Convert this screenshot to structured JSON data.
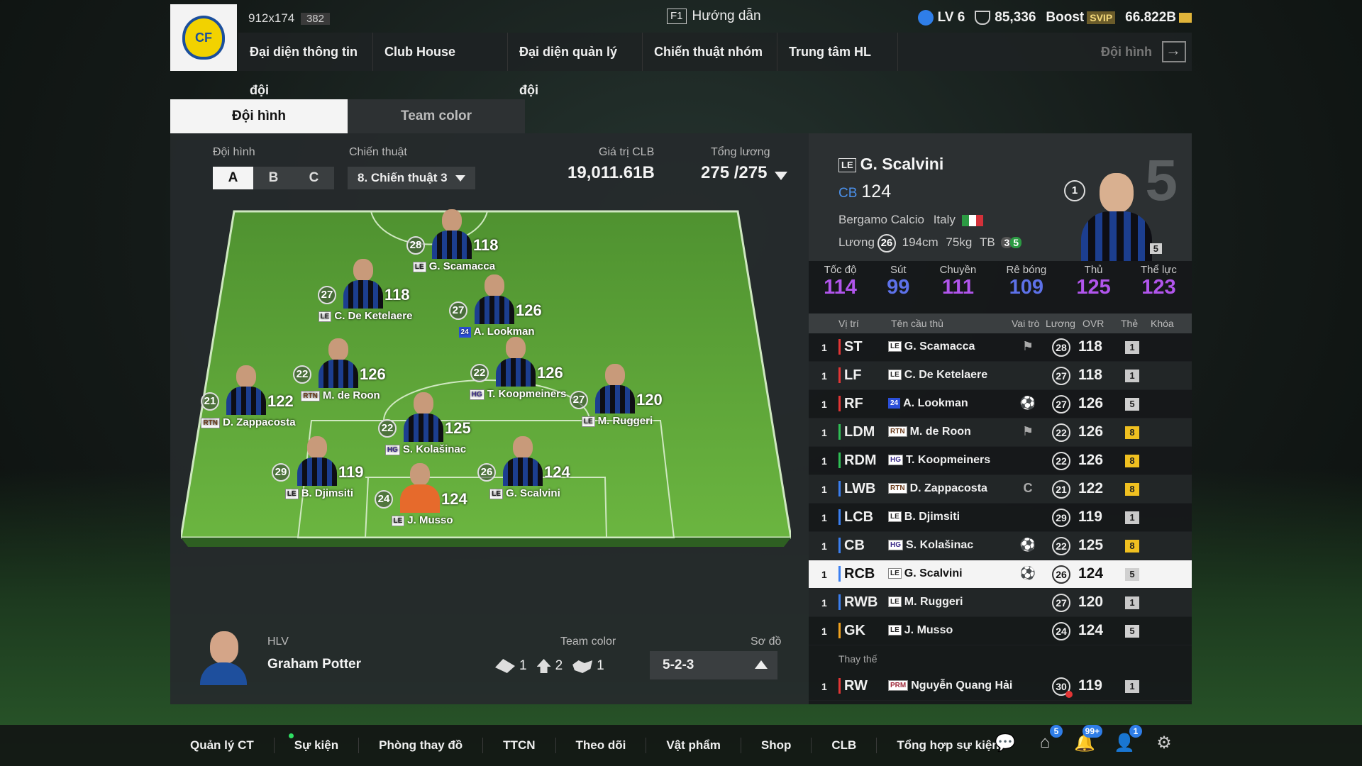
{
  "top": {
    "resolution": "912x174",
    "resolution_count": "382",
    "guide_key": "F1",
    "guide_label": "Hướng dẫn",
    "level": "LV 6",
    "points": "85,336",
    "boost_label": "Boost",
    "svip": "SVIP",
    "currency": "66.822B"
  },
  "nav": {
    "items": [
      "Đại diện thông tin đội",
      "Club House",
      "Đại diện quản lý đội",
      "Chiến thuật nhóm",
      "Trung tâm HL"
    ],
    "right_label": "Đội hình"
  },
  "tabs": [
    "Đội hình",
    "Team color"
  ],
  "left": {
    "formation_label": "Đội hình",
    "abc": [
      "A",
      "B",
      "C"
    ],
    "tactic_label": "Chiến thuật",
    "tactic_value": "8. Chiến thuật 3",
    "club_value_label": "Giá trị CLB",
    "club_value": "19,011.61B",
    "salary_label": "Tổng lương",
    "salary_value": "275 /275",
    "coach_label": "HLV",
    "coach_name": "Graham Potter",
    "team_color_label": "Team color",
    "team_color_values": [
      "1",
      "2",
      "1"
    ],
    "diagram_label": "Sơ đồ",
    "diagram_value": "5-2-3"
  },
  "pitch": [
    {
      "name": "G. Scamacca",
      "pay": "28",
      "ovr": "118",
      "badge": "LE",
      "gk": false
    },
    {
      "name": "C. De Ketelaere",
      "pay": "27",
      "ovr": "118",
      "badge": "LE",
      "gk": false
    },
    {
      "name": "A. Lookman",
      "pay": "27",
      "ovr": "126",
      "badge": "24",
      "gk": false
    },
    {
      "name": "M. de Roon",
      "pay": "22",
      "ovr": "126",
      "badge": "RTN",
      "gk": false
    },
    {
      "name": "T. Koopmeiners",
      "pay": "22",
      "ovr": "126",
      "badge": "HG",
      "gk": false
    },
    {
      "name": "D. Zappacosta",
      "pay": "21",
      "ovr": "122",
      "badge": "RTN",
      "gk": false
    },
    {
      "name": "M. Ruggeri",
      "pay": "27",
      "ovr": "120",
      "badge": "LE",
      "gk": false
    },
    {
      "name": "S. Kolašinac",
      "pay": "22",
      "ovr": "125",
      "badge": "HG",
      "gk": false
    },
    {
      "name": "B. Djimsiti",
      "pay": "29",
      "ovr": "119",
      "badge": "LE",
      "gk": false
    },
    {
      "name": "G. Scalvini",
      "pay": "26",
      "ovr": "124",
      "badge": "LE",
      "gk": false
    },
    {
      "name": "J. Musso",
      "pay": "24",
      "ovr": "124",
      "badge": "LE",
      "gk": true
    }
  ],
  "selected": {
    "badge": "LE",
    "name": "G. Scalvini",
    "pos": "CB",
    "ovr": "124",
    "club": "Bergamo Calcio",
    "nation": "Italy",
    "salary_label": "Lương",
    "salary": "26",
    "height": "194cm",
    "weight": "75kg",
    "body": "TB",
    "foot_left": "3",
    "foot_right": "5",
    "level": "1",
    "card_num": "5",
    "card_tag": "5"
  },
  "attrs": [
    {
      "k": "Tốc độ",
      "v": "114"
    },
    {
      "k": "Sút",
      "v": "99"
    },
    {
      "k": "Chuyền",
      "v": "111"
    },
    {
      "k": "Rê bóng",
      "v": "109"
    },
    {
      "k": "Thủ",
      "v": "125"
    },
    {
      "k": "Thể lực",
      "v": "123"
    }
  ],
  "table": {
    "headers": [
      "Vị trí",
      "Tên cầu thủ",
      "Vai trò",
      "Lương",
      "OVR",
      "Thẻ",
      "Khóa"
    ],
    "rows": [
      {
        "idx": "1",
        "pos": "ST",
        "badge": "LE",
        "name": "G. Scamacca",
        "role": "⚑",
        "pay": "28",
        "ovr": "118",
        "card": "1"
      },
      {
        "idx": "1",
        "pos": "LF",
        "badge": "LE",
        "name": "C. De Ketelaere",
        "role": "",
        "pay": "27",
        "ovr": "118",
        "card": "1"
      },
      {
        "idx": "1",
        "pos": "RF",
        "badge": "24",
        "name": "A. Lookman",
        "role": "⚽",
        "pay": "27",
        "ovr": "126",
        "card": "5"
      },
      {
        "idx": "1",
        "pos": "LDM",
        "badge": "RTN",
        "name": "M. de Roon",
        "role": "⚑",
        "pay": "22",
        "ovr": "126",
        "card": "8"
      },
      {
        "idx": "1",
        "pos": "RDM",
        "badge": "HG",
        "name": "T. Koopmeiners",
        "role": "",
        "pay": "22",
        "ovr": "126",
        "card": "8"
      },
      {
        "idx": "1",
        "pos": "LWB",
        "badge": "RTN",
        "name": "D. Zappacosta",
        "role": "C",
        "pay": "21",
        "ovr": "122",
        "card": "8"
      },
      {
        "idx": "1",
        "pos": "LCB",
        "badge": "LE",
        "name": "B. Djimsiti",
        "role": "",
        "pay": "29",
        "ovr": "119",
        "card": "1"
      },
      {
        "idx": "1",
        "pos": "CB",
        "badge": "HG",
        "name": "S. Kolašinac",
        "role": "⚽",
        "pay": "22",
        "ovr": "125",
        "card": "8"
      },
      {
        "idx": "1",
        "pos": "RCB",
        "badge": "LE",
        "name": "G. Scalvini",
        "role": "⚽",
        "pay": "26",
        "ovr": "124",
        "card": "5"
      },
      {
        "idx": "1",
        "pos": "RWB",
        "badge": "LE",
        "name": "M. Ruggeri",
        "role": "",
        "pay": "27",
        "ovr": "120",
        "card": "1"
      },
      {
        "idx": "1",
        "pos": "GK",
        "badge": "LE",
        "name": "J. Musso",
        "role": "",
        "pay": "24",
        "ovr": "124",
        "card": "5"
      }
    ],
    "sub_label": "Thay thế",
    "sub": {
      "idx": "1",
      "pos": "RW",
      "badge": "PRM",
      "name": "Nguyễn Quang Hải",
      "pay": "30",
      "ovr": "119",
      "card": "1"
    }
  },
  "bottom": {
    "items": [
      "Quản lý CT",
      "Sự kiện",
      "Phòng thay đồ",
      "TTCN",
      "Theo dõi",
      "Vật phẩm",
      "Shop",
      "CLB",
      "Tổng hợp sự kiện"
    ],
    "badges": [
      "5",
      "99+",
      "1"
    ]
  },
  "colors": {
    "accent_purple": "#b155ec",
    "accent_blue": "#4b90ea",
    "gold_card": "#f0c020",
    "pitch_green": "#5fa63a"
  }
}
